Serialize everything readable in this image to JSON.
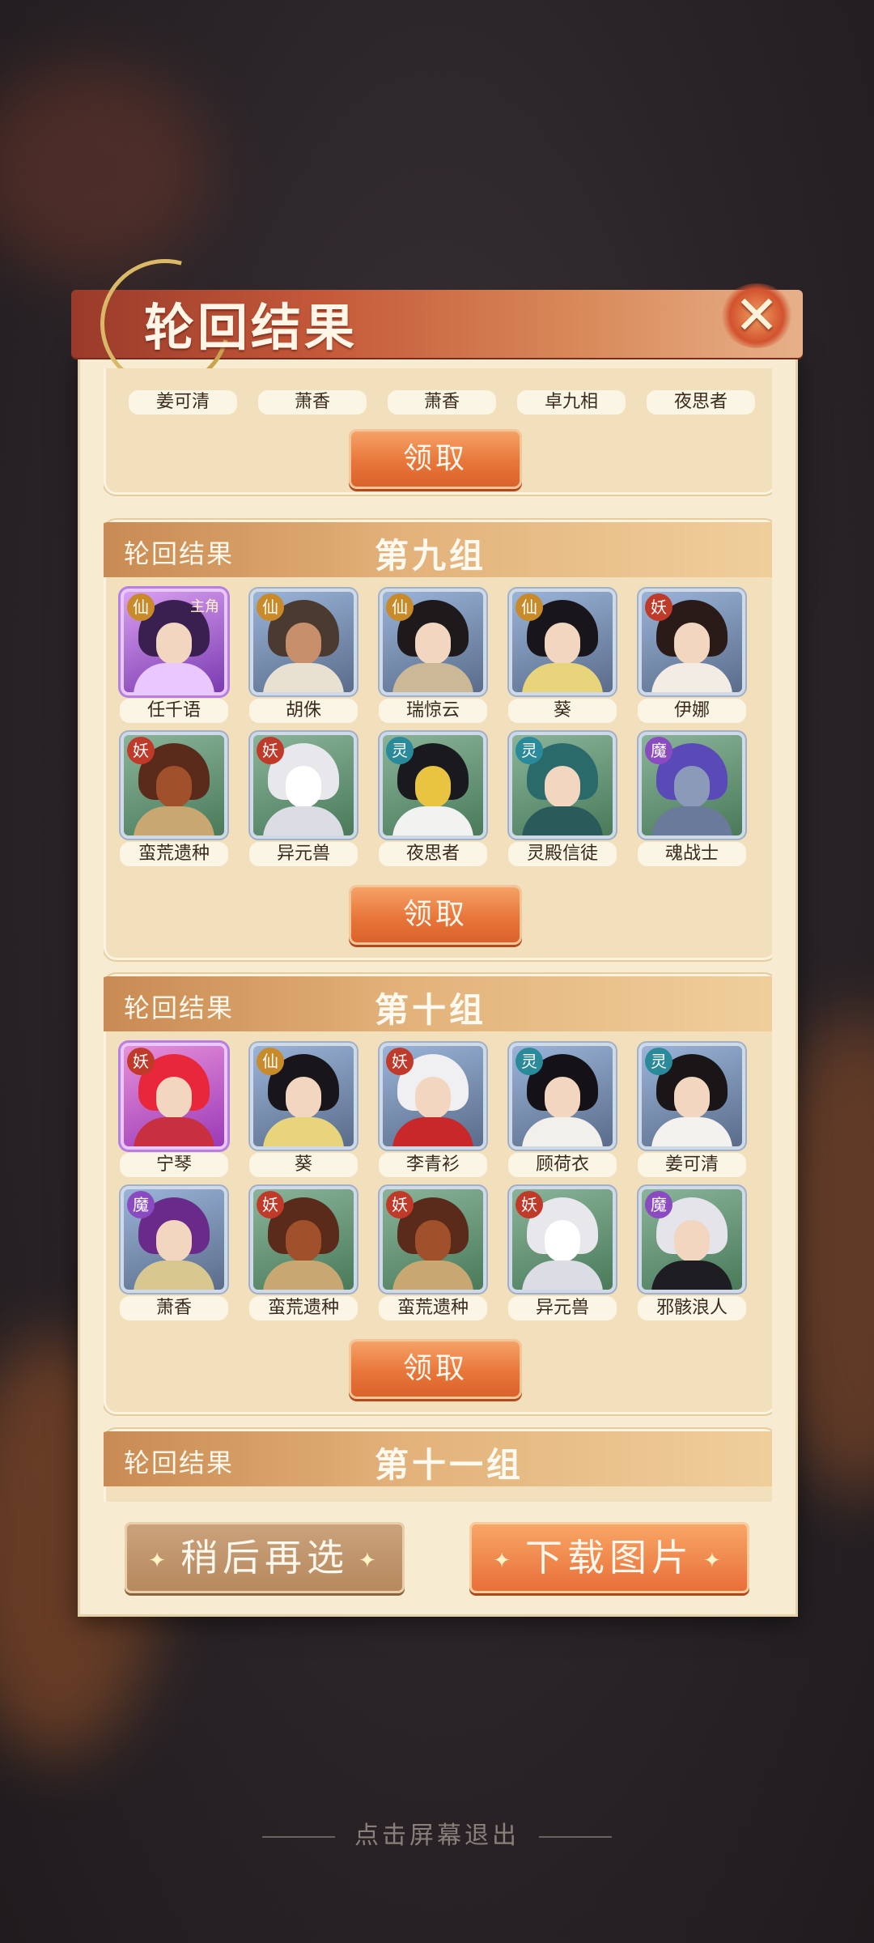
{
  "dialog": {
    "title": "轮回结果",
    "close_label": "✕"
  },
  "top_row": {
    "names": [
      "姜可清",
      "萧香",
      "萧香",
      "卓九相",
      "夜思者"
    ],
    "claim_label": "领取"
  },
  "groups": [
    {
      "label": "轮回结果",
      "group_name": "第九组",
      "claim_label": "领取",
      "heroes": [
        {
          "name": "任千语",
          "tag": "仙",
          "main": "主角"
        },
        {
          "name": "胡侏",
          "tag": "仙"
        },
        {
          "name": "瑞惊云",
          "tag": "仙"
        },
        {
          "name": "葵",
          "tag": "仙"
        },
        {
          "name": "伊娜",
          "tag": "妖"
        },
        {
          "name": "蛮荒遗种",
          "tag": "妖"
        },
        {
          "name": "异元兽",
          "tag": "妖"
        },
        {
          "name": "夜思者",
          "tag": "灵"
        },
        {
          "name": "灵殿信徒",
          "tag": "灵"
        },
        {
          "name": "魂战士",
          "tag": "魔"
        }
      ]
    },
    {
      "label": "轮回结果",
      "group_name": "第十组",
      "claim_label": "领取",
      "heroes": [
        {
          "name": "宁琴",
          "tag": "妖"
        },
        {
          "name": "葵",
          "tag": "仙"
        },
        {
          "name": "李青衫",
          "tag": "妖"
        },
        {
          "name": "顾荷衣",
          "tag": "灵"
        },
        {
          "name": "姜可清",
          "tag": "灵"
        },
        {
          "name": "萧香",
          "tag": "魔"
        },
        {
          "name": "蛮荒遗种",
          "tag": "妖"
        },
        {
          "name": "蛮荒遗种",
          "tag": "妖"
        },
        {
          "name": "异元兽",
          "tag": "妖"
        },
        {
          "name": "邪骸浪人",
          "tag": "魔"
        }
      ]
    },
    {
      "label": "轮回结果",
      "group_name": "第十一组"
    }
  ],
  "buttons": {
    "later": "稍后再选",
    "download": "下载图片"
  },
  "exit_tip": "点击屏幕退出",
  "colors": {
    "accent": "#e8763a",
    "panel": "#f7ecd2",
    "header": "#c55a3a"
  }
}
